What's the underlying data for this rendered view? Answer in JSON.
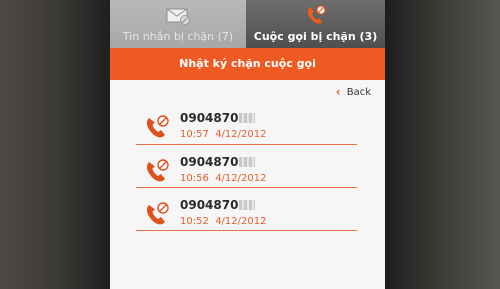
{
  "tabs": [
    {
      "label": "Tin nhắn bị chặn (7)",
      "icon": "envelope-blocked-icon",
      "active": false
    },
    {
      "label": "Cuộc gọi bị chặn (3)",
      "icon": "phone-blocked-icon",
      "active": true
    }
  ],
  "header": {
    "title": "Nhật ký chặn cuộc gọi"
  },
  "back_label": "Back",
  "calls": [
    {
      "number": "0904870",
      "time": "10:57",
      "date": "4/12/2012"
    },
    {
      "number": "0904870",
      "time": "10:56",
      "date": "4/12/2012"
    },
    {
      "number": "0904870",
      "time": "10:52",
      "date": "4/12/2012"
    }
  ],
  "colors": {
    "accent": "#ef5a23",
    "time_text": "#e4602d",
    "active_tab": "#555555"
  }
}
